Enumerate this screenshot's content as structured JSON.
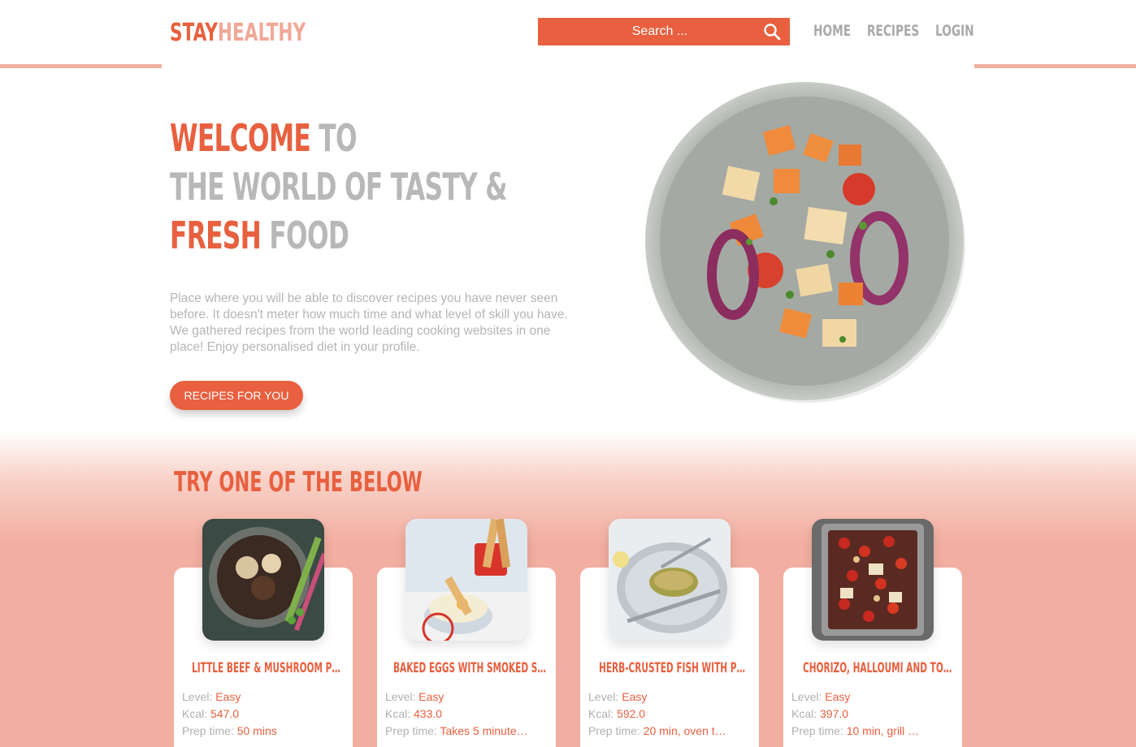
{
  "header": {
    "logo_part1": "STAY",
    "logo_part2": "HEALTHY",
    "search_placeholder": "Search ...",
    "nav": [
      {
        "label": "HOME"
      },
      {
        "label": "RECIPES"
      },
      {
        "label": "LOGIN"
      }
    ]
  },
  "hero": {
    "line1_accent": "WELCOME",
    "line1_rest": " TO",
    "line2": "THE WORLD OF TASTY &",
    "line3_accent": "FRESH",
    "line3_rest": " FOOD",
    "description": "Place where you will be able to discover recipes you have never seen before. It doesn't meter how much time and what level of skill you have. We gathered recipes from the world leading cooking websites in one place! Enjoy personalised diet in your profile.",
    "cta_label": "RECIPES FOR YOU"
  },
  "recipes_section": {
    "title": "TRY ONE OF THE BELOW",
    "level_label": "Level:",
    "kcal_label": "Kcal:",
    "prep_label": "Prep time:",
    "cards": [
      {
        "title": "LITTLE BEEF & MUSHROOM P…",
        "level": "Easy",
        "kcal": "547.0",
        "prep": "50 mins"
      },
      {
        "title": "BAKED EGGS WITH SMOKED S…",
        "level": "Easy",
        "kcal": "433.0",
        "prep": "Takes 5 minute…"
      },
      {
        "title": "HERB-CRUSTED FISH WITH P…",
        "level": "Easy",
        "kcal": "592.0",
        "prep": "20 min, oven t…"
      },
      {
        "title": "CHORIZO, HALLOUMI AND TO…",
        "level": "Easy",
        "kcal": "397.0",
        "prep": "10 min, grill …"
      }
    ]
  },
  "colors": {
    "accent": "#e8603f",
    "light_accent": "#f0a898",
    "grey_text": "#b8b8b8",
    "section_bg": "#f2aea0"
  }
}
